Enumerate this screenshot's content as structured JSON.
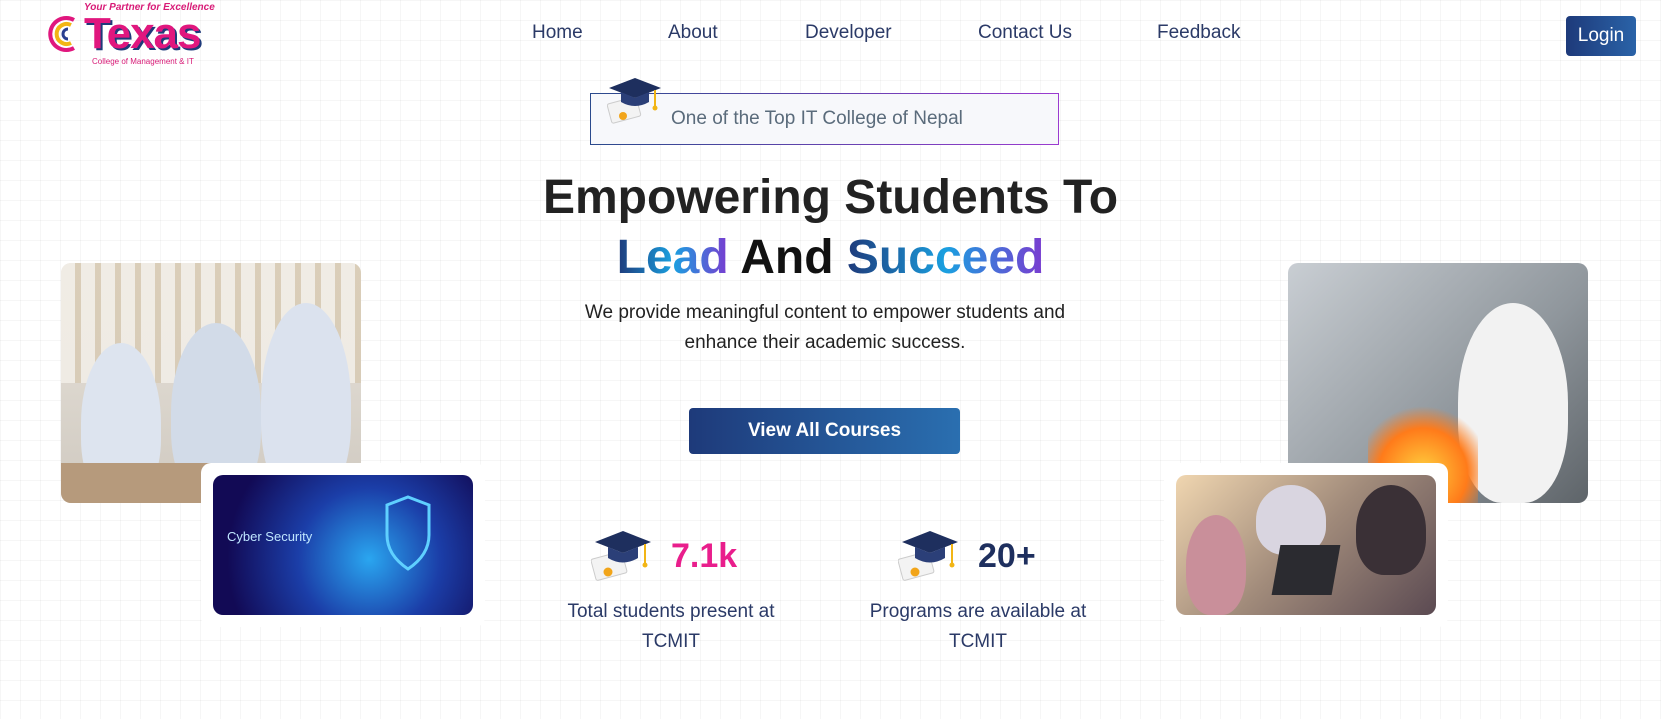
{
  "header": {
    "logo": {
      "tagline": "Your Partner for Excellence",
      "brand": "Texas",
      "subtitle": "College of Management & IT"
    },
    "nav": [
      {
        "label": "Home"
      },
      {
        "label": "About"
      },
      {
        "label": "Developer"
      },
      {
        "label": "Contact Us"
      },
      {
        "label": "Feedback"
      }
    ],
    "login_label": "Login"
  },
  "hero": {
    "badge_text": "One of the Top IT College of Nepal",
    "headline_line1": "Empowering Students To",
    "headline_word_lead": "Lead",
    "headline_word_and": "And",
    "headline_word_succeed": "Succeed",
    "subtitle": "We provide meaningful content to empower students and enhance their academic success.",
    "cta_label": "View All Courses"
  },
  "stats": [
    {
      "value": "7.1k",
      "label": "Total students present at TCMIT",
      "color": "#e91e8c"
    },
    {
      "value": "20+",
      "label": "Programs are available at TCMIT",
      "color": "#1e2f5e"
    }
  ],
  "images": {
    "cyber_caption": "Cyber Security"
  },
  "colors": {
    "brand_navy": "#1e3a7a",
    "brand_pink": "#e0177e",
    "accent_blue": "#2a6fb0"
  }
}
